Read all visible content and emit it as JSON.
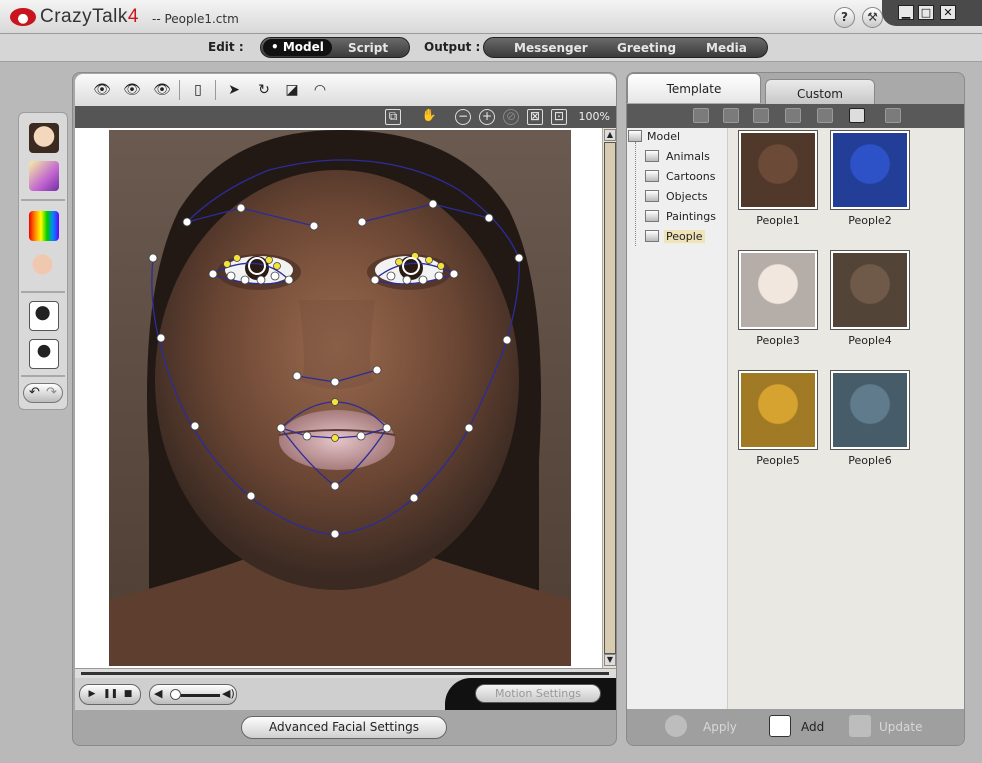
{
  "window": {
    "app_name_prefix": "CrazyTalk",
    "app_name_version": "4",
    "document": "-- People1.ctm",
    "help_label": "?"
  },
  "modebar": {
    "edit_label": "Edit :",
    "edit_modes": [
      "Model",
      "Script"
    ],
    "output_label": "Output :",
    "output_modes": [
      "Messenger",
      "Greeting",
      "Media"
    ]
  },
  "viewer": {
    "zoom": "100%",
    "motion_settings": "Motion Settings",
    "advanced_facial_settings": "Advanced Facial Settings"
  },
  "right_panel": {
    "tabs": [
      "Template",
      "Custom"
    ],
    "tree": {
      "root": "Model",
      "children": [
        "Animals",
        "Cartoons",
        "Objects",
        "Paintings",
        "People"
      ],
      "selected": "People"
    },
    "templates": [
      {
        "label": "People1",
        "color": "#6b4a38"
      },
      {
        "label": "People2",
        "color": "#2d52c8"
      },
      {
        "label": "People3",
        "color": "#f1e7df"
      },
      {
        "label": "People4",
        "color": "#6f5a4a"
      },
      {
        "label": "People5",
        "color": "#d6a230"
      },
      {
        "label": "People6",
        "color": "#5f7b8c"
      }
    ],
    "actions": {
      "apply": "Apply",
      "add": "Add",
      "update": "Update"
    }
  },
  "colors": {
    "accent_red": "#c8141c",
    "dark_bar": "#555555",
    "face_point": "#ffffff",
    "face_point_active": "#f5e33a",
    "face_outline": "#2c2c9a"
  }
}
